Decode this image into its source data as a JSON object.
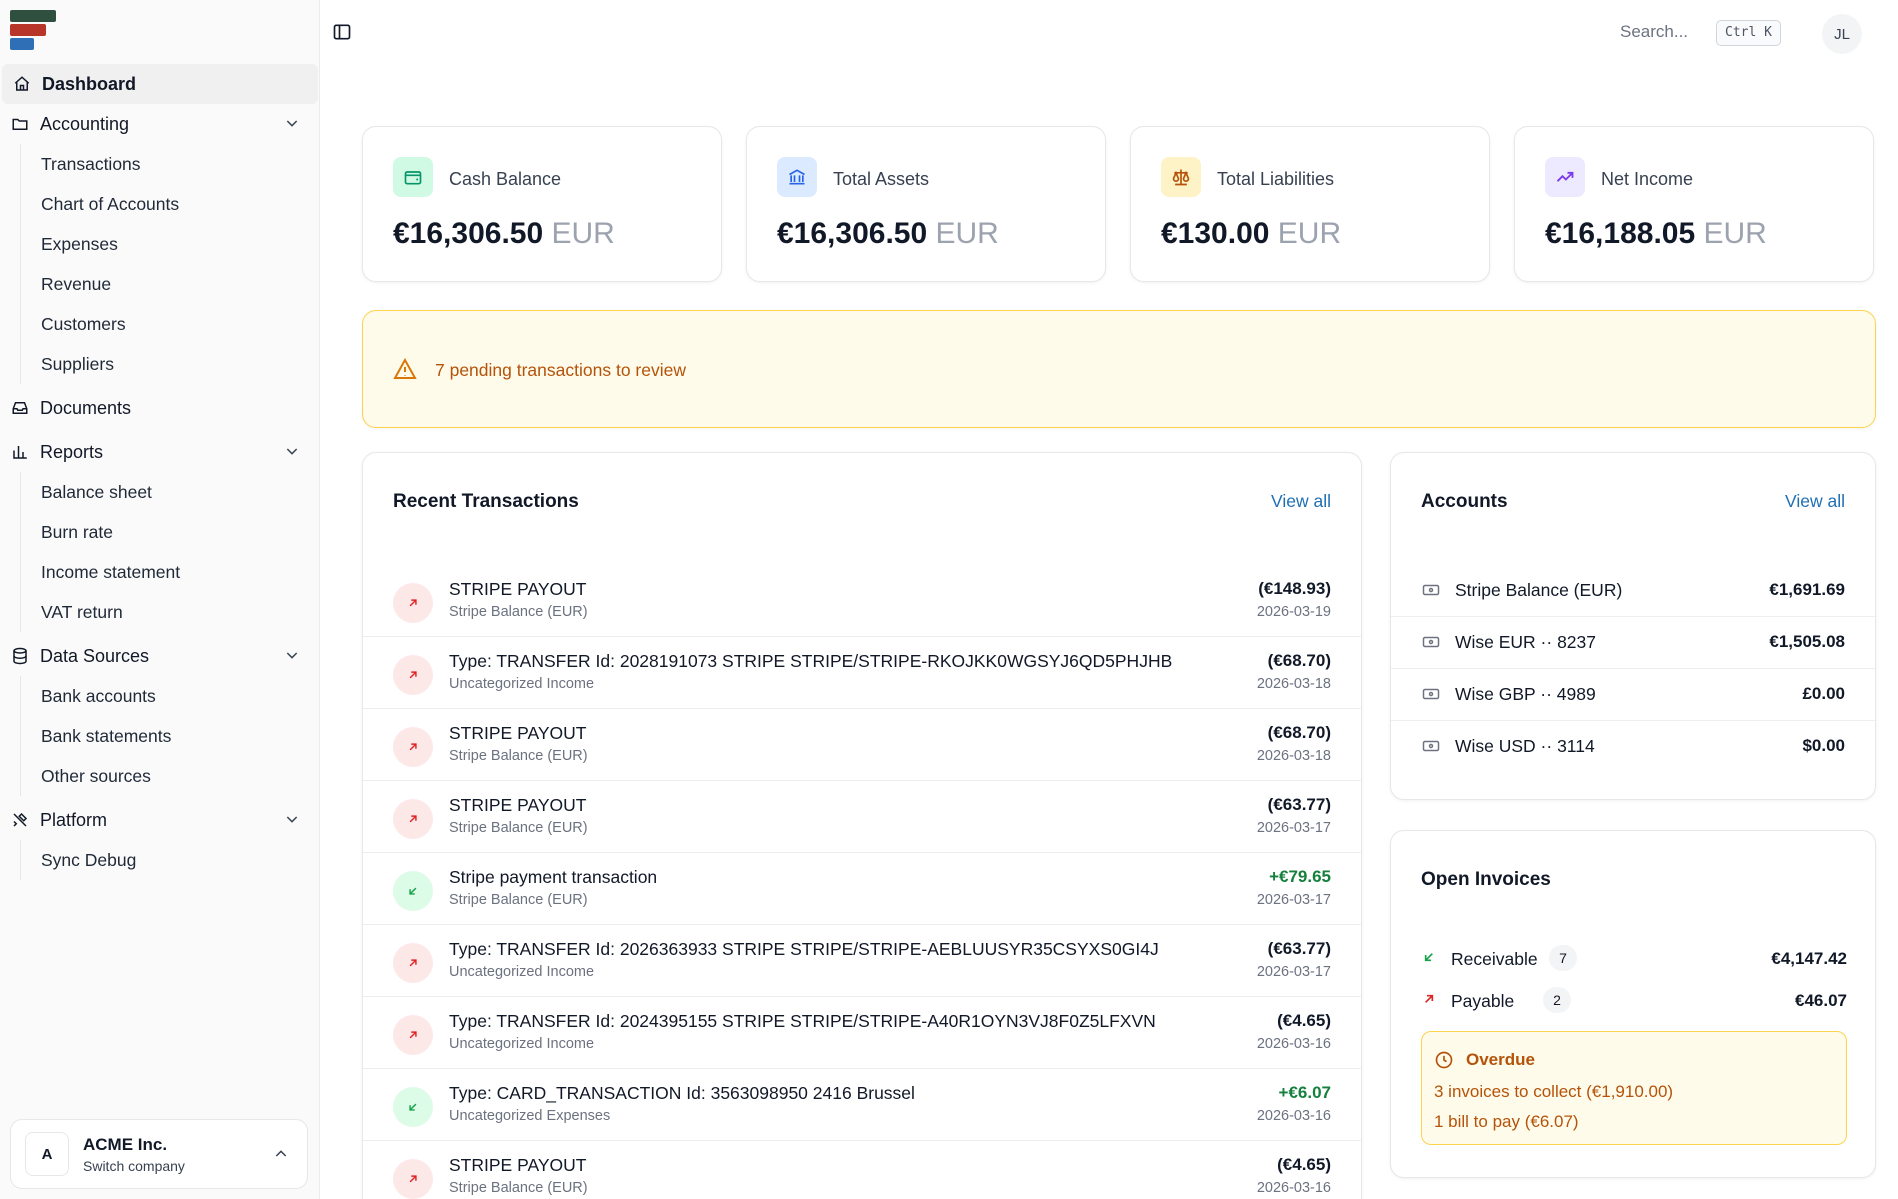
{
  "brand": {
    "colors": [
      "#2f4f3f",
      "#b8352a",
      "#2f6fb5"
    ]
  },
  "sidebar": {
    "dashboard": "Dashboard",
    "accounting": {
      "label": "Accounting",
      "items": [
        "Transactions",
        "Chart of Accounts",
        "Expenses",
        "Revenue",
        "Customers",
        "Suppliers"
      ]
    },
    "documents": "Documents",
    "reports": {
      "label": "Reports",
      "items": [
        "Balance sheet",
        "Burn rate",
        "Income statement",
        "VAT return"
      ]
    },
    "data_sources": {
      "label": "Data Sources",
      "items": [
        "Bank accounts",
        "Bank statements",
        "Other sources"
      ]
    },
    "platform": {
      "label": "Platform",
      "items": [
        "Sync Debug"
      ]
    },
    "company": {
      "initial": "A",
      "name": "ACME Inc.",
      "action": "Switch company"
    }
  },
  "topbar": {
    "search_placeholder": "Search...",
    "shortcut": "Ctrl K",
    "user_initials": "JL"
  },
  "stats": [
    {
      "label": "Cash Balance",
      "amount": "€16,306.50",
      "currency": "EUR",
      "icon": "wallet-icon",
      "color": "#059669",
      "bg": "#d1fae5"
    },
    {
      "label": "Total Assets",
      "amount": "€16,306.50",
      "currency": "EUR",
      "icon": "bank-icon",
      "color": "#2563eb",
      "bg": "#dbeafe"
    },
    {
      "label": "Total Liabilities",
      "amount": "€130.00",
      "currency": "EUR",
      "icon": "scale-icon",
      "color": "#b45309",
      "bg": "#fef3c7"
    },
    {
      "label": "Net Income",
      "amount": "€16,188.05",
      "currency": "EUR",
      "icon": "trending-up-icon",
      "color": "#7c3aed",
      "bg": "#ede9fe"
    }
  ],
  "alert": {
    "text": "7 pending transactions to review"
  },
  "transactions": {
    "title": "Recent Transactions",
    "view_all": "View all",
    "rows": [
      {
        "direction": "out",
        "title": "STRIPE PAYOUT",
        "account": "Stripe Balance (EUR)",
        "amount": "(€148.93)",
        "date": "2026-03-19"
      },
      {
        "direction": "out",
        "title": "Type: TRANSFER Id: 2028191073 STRIPE STRIPE/STRIPE-RKOJKK0WGSYJ6QD5PHJHB",
        "account": "Uncategorized Income",
        "amount": "(€68.70)",
        "date": "2026-03-18"
      },
      {
        "direction": "out",
        "title": "STRIPE PAYOUT",
        "account": "Stripe Balance (EUR)",
        "amount": "(€68.70)",
        "date": "2026-03-18"
      },
      {
        "direction": "out",
        "title": "STRIPE PAYOUT",
        "account": "Stripe Balance (EUR)",
        "amount": "(€63.77)",
        "date": "2026-03-17"
      },
      {
        "direction": "in",
        "title": "Stripe payment transaction",
        "account": "Stripe Balance (EUR)",
        "amount": "+€79.65",
        "date": "2026-03-17"
      },
      {
        "direction": "out",
        "title": "Type: TRANSFER Id: 2026363933 STRIPE STRIPE/STRIPE-AEBLUUSYR35CSYXS0GI4J",
        "account": "Uncategorized Income",
        "amount": "(€63.77)",
        "date": "2026-03-17"
      },
      {
        "direction": "out",
        "title": "Type: TRANSFER Id: 2024395155 STRIPE STRIPE/STRIPE-A40R1OYN3VJ8F0Z5LFXVN",
        "account": "Uncategorized Income",
        "amount": "(€4.65)",
        "date": "2026-03-16"
      },
      {
        "direction": "in",
        "title": "Type: CARD_TRANSACTION Id: 3563098950 2416 Brussel",
        "account": "Uncategorized Expenses",
        "amount": "+€6.07",
        "date": "2026-03-16"
      },
      {
        "direction": "out",
        "title": "STRIPE PAYOUT",
        "account": "Stripe Balance (EUR)",
        "amount": "(€4.65)",
        "date": "2026-03-16"
      }
    ]
  },
  "accounts": {
    "title": "Accounts",
    "view_all": "View all",
    "rows": [
      {
        "name": "Stripe Balance (EUR)",
        "balance": "€1,691.69"
      },
      {
        "name": "Wise EUR ·· 8237",
        "balance": "€1,505.08"
      },
      {
        "name": "Wise GBP ·· 4989",
        "balance": "£0.00"
      },
      {
        "name": "Wise USD ·· 3114",
        "balance": "$0.00"
      }
    ]
  },
  "invoices": {
    "title": "Open Invoices",
    "receivable": {
      "label": "Receivable",
      "count": "7",
      "amount": "€4,147.42"
    },
    "payable": {
      "label": "Payable",
      "count": "2",
      "amount": "€46.07"
    },
    "overdue": {
      "title": "Overdue",
      "collect": "3 invoices to collect (€1,910.00)",
      "pay": "1 bill to pay (€6.07)"
    }
  }
}
